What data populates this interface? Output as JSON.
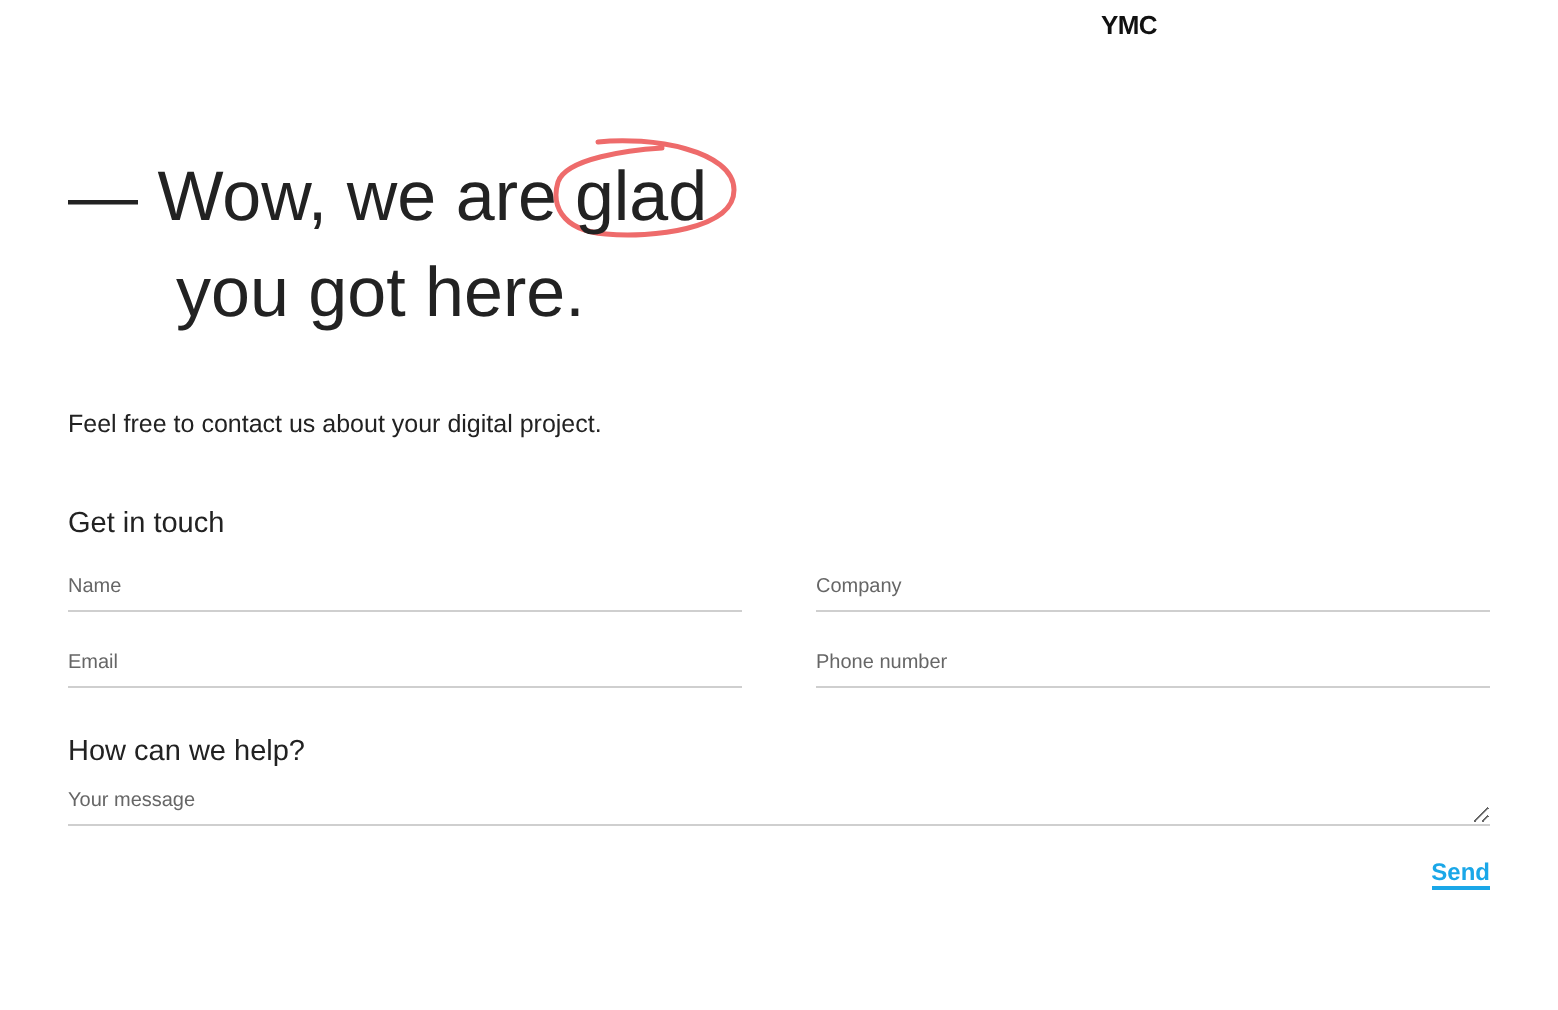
{
  "logo": "YMC",
  "headline": {
    "line_1": "— Wow, we are",
    "circled_word": "glad",
    "line_2": "you got here."
  },
  "intro": "Feel free to contact us about your digital project.",
  "contact": {
    "title": "Get in touch",
    "fields": [
      {
        "placeholder": "Name"
      },
      {
        "placeholder": "Company"
      },
      {
        "placeholder": "Email"
      },
      {
        "placeholder": "Phone number"
      }
    ]
  },
  "help": {
    "title": "How can we help?",
    "message": {
      "placeholder": "Your message"
    }
  },
  "send_button": "Send"
}
